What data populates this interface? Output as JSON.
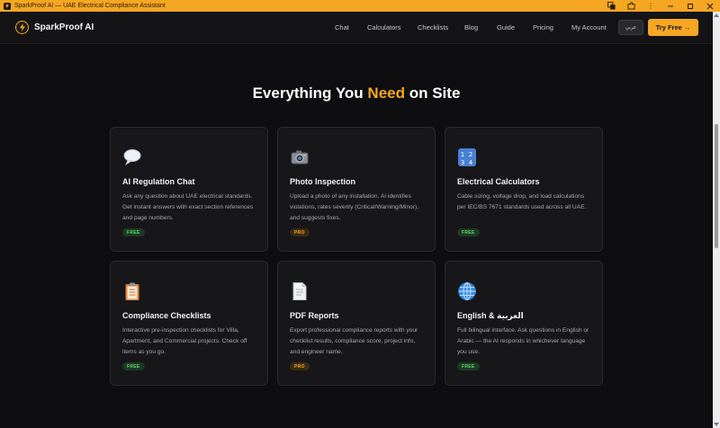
{
  "window": {
    "title": "SparkProof AI — UAE Electrical Compliance Assistant",
    "controls": [
      "translate-icon",
      "extensions-icon",
      "more-icon",
      "minimize-icon",
      "maximize-icon",
      "close-icon"
    ]
  },
  "nav": {
    "brand": "SparkProof AI",
    "links": [
      "Chat",
      "Calculators",
      "Checklists",
      "Blog",
      "Guide",
      "Pricing",
      "My Account"
    ],
    "lang_button": "عربي",
    "cta": "Try Free →"
  },
  "section": {
    "heading_pre": "Everything You ",
    "heading_accent": "Need",
    "heading_post": " on Site",
    "cards": [
      {
        "icon": "speech-bubble-icon",
        "title": "AI Regulation Chat",
        "desc": "Ask any question about UAE electrical standards. Get instant answers with exact section references and page numbers.",
        "badge": "FREE"
      },
      {
        "icon": "camera-icon",
        "title": "Photo Inspection",
        "desc": "Upload a photo of any installation. AI identifies violations, rates severity (Critical/Warning/Minor), and suggests fixes.",
        "badge": "PRO"
      },
      {
        "icon": "numbers-icon",
        "title": "Electrical Calculators",
        "desc": "Cable sizing, voltage drop, and load calculations per IEC/BS 7671 standards used across all UAE.",
        "badge": "FREE"
      },
      {
        "icon": "clipboard-icon",
        "title": "Compliance Checklists",
        "desc": "Interactive pre-inspection checklists for Villa, Apartment, and Commercial projects. Check off items as you go.",
        "badge": "FREE"
      },
      {
        "icon": "document-icon",
        "title": "PDF Reports",
        "desc": "Export professional compliance reports with your checklist results, compliance score, project info, and engineer name.",
        "badge": "PRO"
      },
      {
        "icon": "globe-icon",
        "title": "English & العربية",
        "desc": "Full bilingual interface. Ask questions in English or Arabic — the AI responds in whichever language you use.",
        "badge": "FREE"
      }
    ]
  },
  "colors": {
    "accent": "#f5a623",
    "background": "#0e0e10",
    "card": "#17171a",
    "free_badge": "#5fd36b",
    "pro_badge": "#f5a623"
  }
}
